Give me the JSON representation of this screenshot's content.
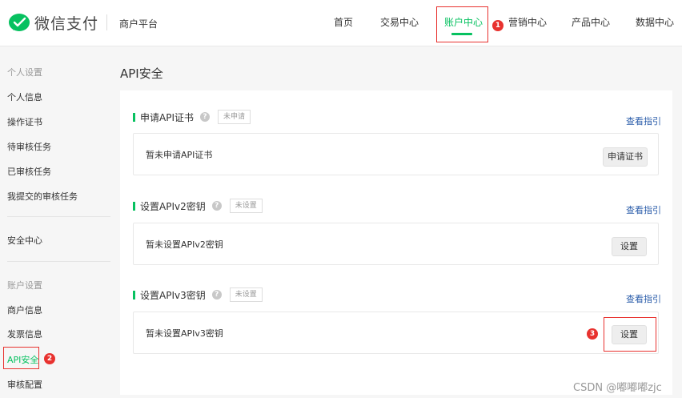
{
  "colors": {
    "accent": "#07c160",
    "annotation": "#e8322f",
    "link": "#2a5caa"
  },
  "header": {
    "brand": "微信支付",
    "platform": "商户平台",
    "nav": [
      "首页",
      "交易中心",
      "账户中心",
      "营销中心",
      "产品中心",
      "数据中心"
    ],
    "active_nav": "账户中心"
  },
  "sidebar": {
    "group1_label": "个人设置",
    "group1_items": [
      "个人信息",
      "操作证书",
      "待审核任务",
      "已审核任务",
      "我提交的审核任务"
    ],
    "security_center": "安全中心",
    "group2_label": "账户设置",
    "group2_items": [
      "商户信息",
      "发票信息",
      "API安全",
      "审核配置"
    ],
    "active_item": "API安全"
  },
  "main": {
    "title": "API安全",
    "sections": [
      {
        "title": "申请API证书",
        "status": "未申请",
        "guide": "查看指引",
        "card_text": "暂未申请API证书",
        "button": "申请证书"
      },
      {
        "title": "设置APIv2密钥",
        "status": "未设置",
        "guide": "查看指引",
        "card_text": "暂未设置APIv2密钥",
        "button": "设置"
      },
      {
        "title": "设置APIv3密钥",
        "status": "未设置",
        "guide": "查看指引",
        "card_text": "暂未设置APIv3密钥",
        "button": "设置"
      }
    ]
  },
  "annotations": [
    "1",
    "2",
    "3"
  ],
  "watermark": "CSDN @嘟嘟嘟zjc"
}
